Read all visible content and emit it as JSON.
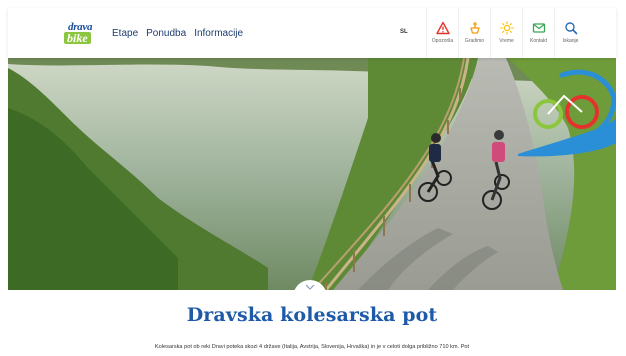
{
  "logo": {
    "top": "drava",
    "bottom": "bike"
  },
  "nav": [
    {
      "label": "Etape"
    },
    {
      "label": "Ponudba"
    },
    {
      "label": "Informacije"
    }
  ],
  "lang": "SL",
  "tools": [
    {
      "label": "Opozorila",
      "icon": "warning-icon",
      "color": "#e2342d"
    },
    {
      "label": "Gradimo",
      "icon": "construction-icon",
      "color": "#f39c12"
    },
    {
      "label": "Vreme",
      "icon": "sun-icon",
      "color": "#f6c20c"
    },
    {
      "label": "Kontakt",
      "icon": "mail-icon",
      "color": "#3aa655"
    },
    {
      "label": "Iskanje",
      "icon": "search-icon",
      "color": "#2a6db5"
    }
  ],
  "page": {
    "title": "Dravska kolesarska pot",
    "intro": "Kolesarska pot ob reki Dravi poteka skozi 4 države (Italija, Avstrija, Slovenija, Hrvaška) in je v celoti dolga približno 710 km. Pot"
  },
  "colors": {
    "brand_blue": "#1f5aa8",
    "brand_green": "#8cc63f",
    "nav_text": "#1d3d6e"
  }
}
